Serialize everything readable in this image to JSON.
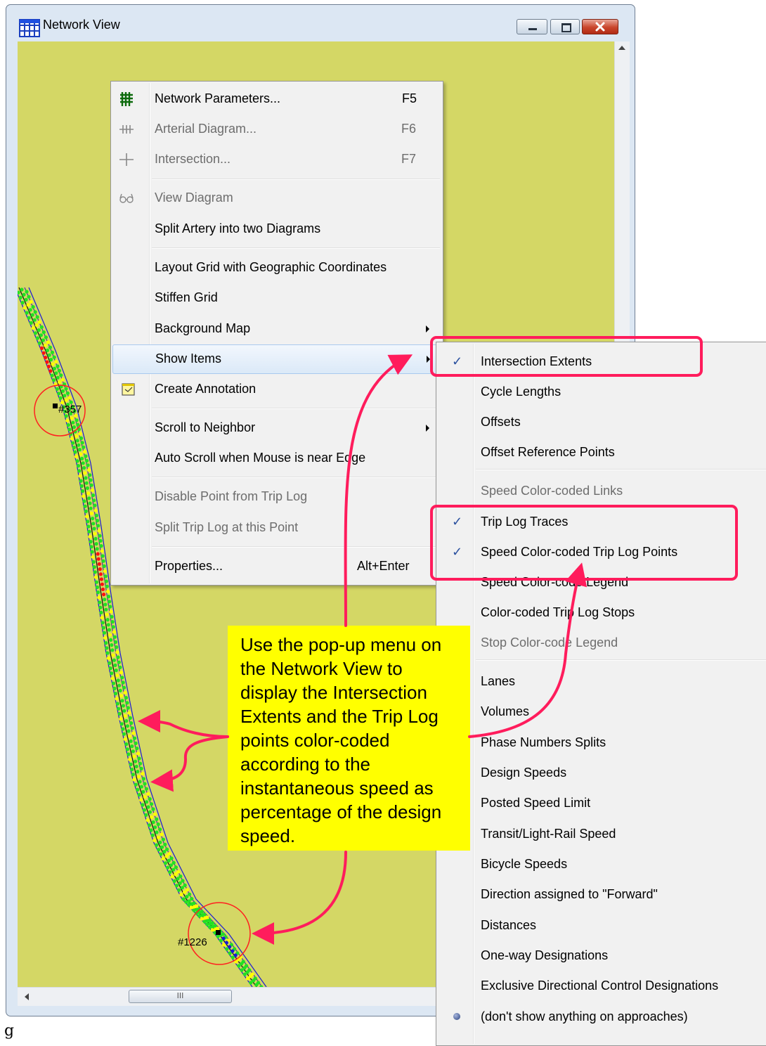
{
  "window": {
    "title": "Network View"
  },
  "node_labels": [
    "#357",
    "#1226"
  ],
  "scrollbar": {
    "thumb_label": "III"
  },
  "context_menu": {
    "items": [
      {
        "label": "Network Parameters...",
        "shortcut": "F5",
        "icon": "grid-icon",
        "enabled": true
      },
      {
        "label": "Arterial Diagram...",
        "shortcut": "F6",
        "icon": "arterial-icon",
        "enabled": false
      },
      {
        "label": "Intersection...",
        "shortcut": "F7",
        "icon": "plus-icon",
        "enabled": false
      },
      {
        "label": "View Diagram",
        "shortcut": "",
        "icon": "glasses-icon",
        "enabled": false
      },
      {
        "label": "Split Artery into two Diagrams",
        "shortcut": "",
        "icon": "",
        "enabled": true
      },
      {
        "label": "Layout Grid with Geographic Coordinates",
        "shortcut": "",
        "icon": "",
        "enabled": true
      },
      {
        "label": "Stiffen Grid",
        "shortcut": "",
        "icon": "",
        "enabled": true
      },
      {
        "label": "Background Map",
        "shortcut": "",
        "icon": "",
        "enabled": true,
        "submenu": true
      },
      {
        "label": "Show Items",
        "shortcut": "",
        "icon": "",
        "enabled": true,
        "submenu": true,
        "highlighted": true
      },
      {
        "label": "Create Annotation",
        "shortcut": "",
        "icon": "note-icon",
        "enabled": true
      },
      {
        "label": "Scroll to Neighbor",
        "shortcut": "",
        "icon": "",
        "enabled": true,
        "submenu": true
      },
      {
        "label": "Auto Scroll when Mouse is near Edge",
        "shortcut": "",
        "icon": "",
        "enabled": true
      },
      {
        "label": "Disable Point from Trip Log",
        "shortcut": "",
        "icon": "",
        "enabled": false
      },
      {
        "label": "Split Trip Log at this Point",
        "shortcut": "",
        "icon": "",
        "enabled": false
      },
      {
        "label": "Properties...",
        "shortcut": "Alt+Enter",
        "icon": "",
        "enabled": true
      }
    ]
  },
  "show_items_menu": {
    "items": [
      {
        "label": "Intersection Extents",
        "checked": true,
        "enabled": true
      },
      {
        "label": "Cycle Lengths",
        "checked": false,
        "enabled": true
      },
      {
        "label": "Offsets",
        "checked": false,
        "enabled": true
      },
      {
        "label": "Offset Reference Points",
        "checked": false,
        "enabled": true
      },
      {
        "label": "Speed Color-coded Links",
        "checked": false,
        "enabled": false
      },
      {
        "label": "Trip Log Traces",
        "checked": true,
        "enabled": true
      },
      {
        "label": "Speed Color-coded Trip Log Points",
        "checked": true,
        "enabled": true
      },
      {
        "label": "Speed Color-code Legend",
        "checked": false,
        "enabled": true
      },
      {
        "label": "Color-coded Trip Log Stops",
        "checked": false,
        "enabled": true
      },
      {
        "label": "Stop Color-code Legend",
        "checked": false,
        "enabled": false
      },
      {
        "label": "Lanes",
        "checked": false,
        "enabled": true
      },
      {
        "label": "Volumes",
        "checked": false,
        "enabled": true
      },
      {
        "label": "Phase Numbers  Splits",
        "checked": false,
        "enabled": true
      },
      {
        "label": "Design Speeds",
        "checked": false,
        "enabled": true
      },
      {
        "label": "Posted Speed Limit",
        "checked": false,
        "enabled": true
      },
      {
        "label": "Transit/Light-Rail Speed",
        "checked": false,
        "enabled": true
      },
      {
        "label": "Bicycle Speeds",
        "checked": false,
        "enabled": true
      },
      {
        "label": "Direction assigned to \"Forward\"",
        "checked": false,
        "enabled": true
      },
      {
        "label": "Distances",
        "checked": false,
        "enabled": true
      },
      {
        "label": "One-way Designations",
        "checked": false,
        "enabled": true
      },
      {
        "label": "Exclusive Directional Control Designations",
        "checked": false,
        "enabled": true
      },
      {
        "label": "(don't show anything on approaches)",
        "checked": false,
        "radio": true,
        "enabled": true
      }
    ]
  },
  "callout": {
    "text": "Use the pop-up menu on the Network View to display the Intersection Extents and the Trip Log points color-coded according to the instantaneous speed as percentage of the design speed."
  },
  "colors": {
    "canvas": "#d4d765",
    "annotation": "#ff1c5c",
    "callout_bg": "#ffff00",
    "trip_point": "#22e022",
    "trip_point_alt": "#ffff00",
    "slow_point": "#ff1010",
    "intersection_circle": "#ff2020",
    "route_line": "#1a1ad6"
  }
}
